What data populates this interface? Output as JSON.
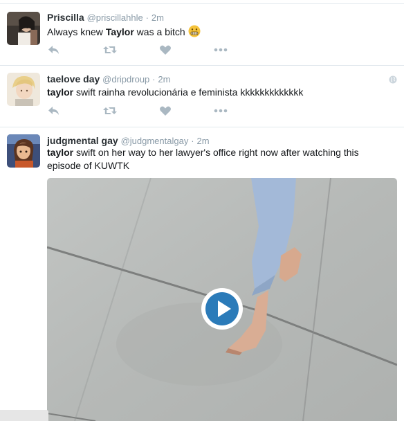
{
  "tweets": [
    {
      "name": "Priscilla",
      "handle": "@priscillahhle",
      "dot": "·",
      "time": "2m",
      "text_before": "Always knew ",
      "text_bold": "Taylor",
      "text_after": " was a bitch",
      "emoji": "grimacing-face-emoji"
    },
    {
      "name": "taelove day",
      "handle": "@dripdroup",
      "dot": "·",
      "time": "2m",
      "text_bold": "taylor",
      "text_after": " swift rainha revolucionária e feminista kkkkkkkkkkkkk"
    },
    {
      "name": "judgmental gay",
      "handle": "@judgmentalgay",
      "dot": "·",
      "time": "2m",
      "text_bold": "taylor",
      "text_after": " swift on her way to her lawyer's office right now after watching this episode of KUWTK",
      "media": "video-thumbnail"
    }
  ],
  "icons": {
    "reply": "reply-icon",
    "retweet": "retweet-icon",
    "like": "heart-icon",
    "more": "more-icon",
    "globe": "globe-icon",
    "play": "play-icon"
  },
  "colors": {
    "name": "#292f33",
    "meta": "#8899a6",
    "action": "#aab8c2",
    "play_blue": "#2b7bb9",
    "divider": "#e1e8ed"
  }
}
